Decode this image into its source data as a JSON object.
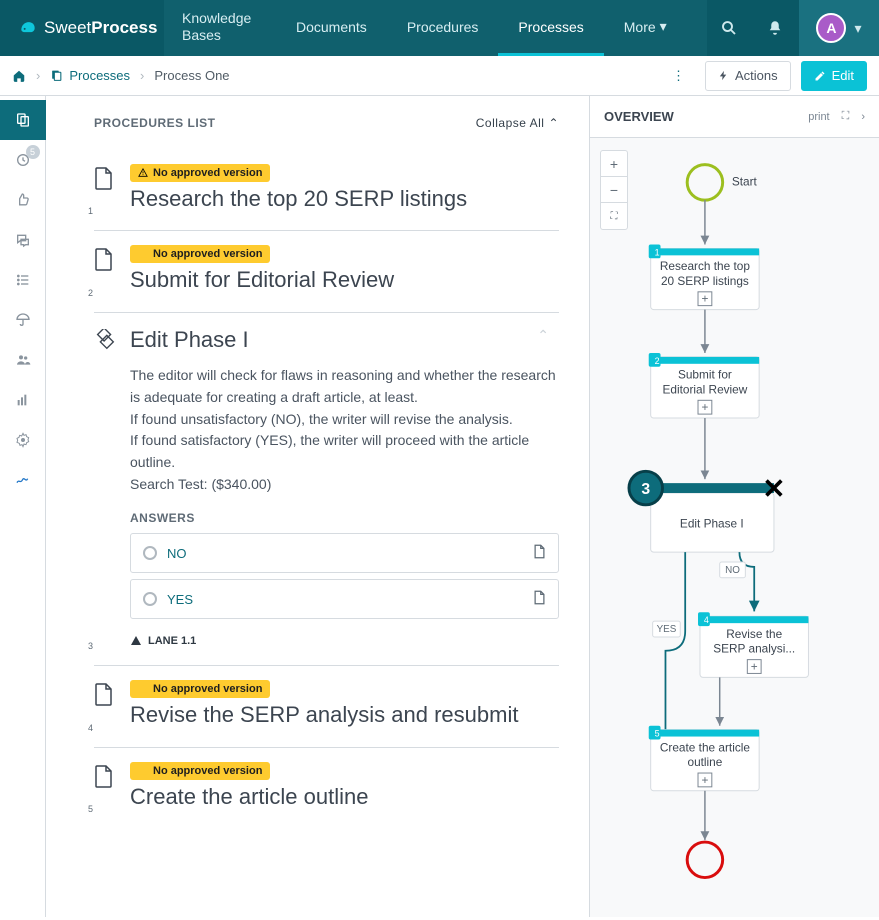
{
  "brand": {
    "sweet": "Sweet",
    "process": "Process"
  },
  "nav": {
    "kb": "Knowledge Bases",
    "documents": "Documents",
    "procedures": "Procedures",
    "processes": "Processes",
    "more": "More"
  },
  "avatar_initial": "A",
  "crumb": {
    "processes": "Processes",
    "current": "Process One"
  },
  "actions": {
    "actions": "Actions",
    "edit": "Edit"
  },
  "rail_badge": "5",
  "list": {
    "heading": "PROCEDURES LIST",
    "collapse": "Collapse All",
    "warn_label": "No approved version",
    "items": [
      {
        "num": "1",
        "title": "Research the top 20 SERP listings"
      },
      {
        "num": "2",
        "title": "Submit for Editorial Review"
      },
      {
        "num": "3",
        "title": "Edit Phase I",
        "desc": [
          "The editor will check for flaws in reasoning and whether the research is adequate for creating a draft article, at least.",
          "If found unsatisfactory (NO), the writer will revise the analysis.",
          "If found satisfactory (YES), the writer will proceed with the article outline.",
          "Search Test: ($340.00)"
        ]
      },
      {
        "num": "4",
        "title": "Revise the SERP analysis and resubmit"
      },
      {
        "num": "5",
        "title": "Create the article outline"
      }
    ],
    "answers_head": "ANSWERS",
    "answers": [
      {
        "label": "NO"
      },
      {
        "label": "YES"
      }
    ],
    "lane": "LANE 1.1"
  },
  "overview": {
    "heading": "OVERVIEW",
    "print": "print",
    "start": "Start",
    "nodes": {
      "n1": {
        "num": "1",
        "l1": "Research the top",
        "l2": "20 SERP listings"
      },
      "n2": {
        "num": "2",
        "l1": "Submit for",
        "l2": "Editorial Review"
      },
      "n3": {
        "num": "3",
        "l1": "Edit Phase I"
      },
      "n4": {
        "num": "4",
        "l1": "Revise the",
        "l2": "SERP analysi..."
      },
      "n5": {
        "num": "5",
        "l1": "Create the article",
        "l2": "outline"
      }
    },
    "no": "NO",
    "yes": "YES"
  }
}
